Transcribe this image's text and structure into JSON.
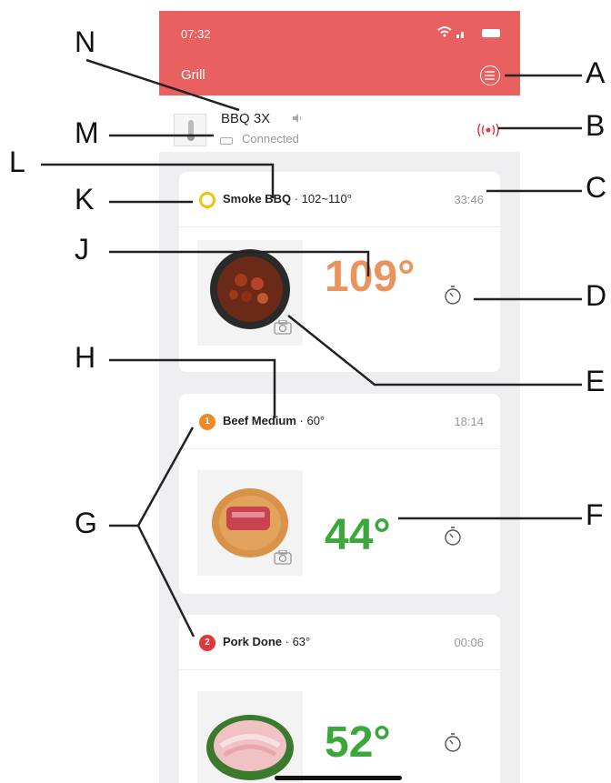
{
  "status_bar": {
    "time": "07:32"
  },
  "header": {
    "title": "Grill",
    "menu_icon": "list-icon"
  },
  "device": {
    "name": "BBQ 3X",
    "status": "Connected",
    "alarm_icon": "alarm-icon"
  },
  "probes": [
    {
      "badge": "",
      "name": "Smoke BBQ",
      "target": "· 102~110°",
      "timer": "33:46",
      "temp": "109°",
      "temp_color": "#e8945c",
      "badge_color": "#f4c10c",
      "food": "bbq-skewers-image"
    },
    {
      "badge": "1",
      "name": "Beef Medium",
      "target": "· 60°",
      "timer": "18:14",
      "temp": "44°",
      "temp_color": "#3aa83a",
      "badge_color": "#ef8a26",
      "food": "beef-image"
    },
    {
      "badge": "2",
      "name": "Pork Done",
      "target": "· 63°",
      "timer": "00:06",
      "temp": "52°",
      "temp_color": "#3aa83a",
      "badge_color": "#e0373a",
      "food": "pork-image"
    }
  ],
  "callouts": {
    "A": "A",
    "B": "B",
    "C": "C",
    "D": "D",
    "E": "E",
    "F": "F",
    "G": "G",
    "H": "H",
    "J": "J",
    "K": "K",
    "L": "L",
    "M": "M",
    "N": "N"
  }
}
